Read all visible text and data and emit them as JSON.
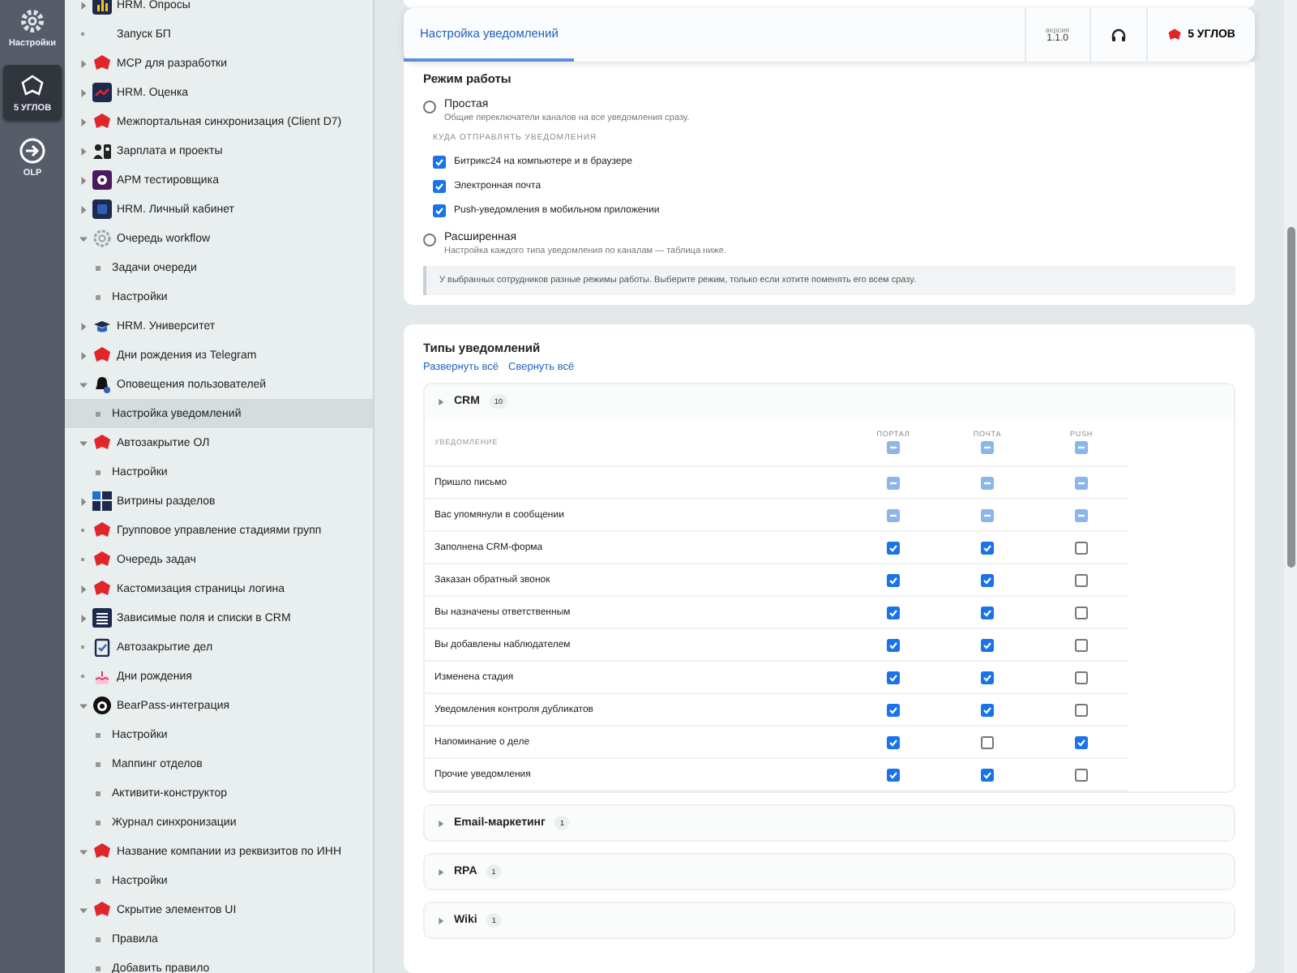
{
  "rail": [
    {
      "label": "Настройки",
      "selected": false
    },
    {
      "label": "5 УГЛОВ",
      "selected": true
    },
    {
      "label": "OLP",
      "selected": false
    }
  ],
  "sidebar": {
    "items": [
      {
        "label": "HRM. Опросы",
        "kind": "folder",
        "expanded": false,
        "selected": false
      },
      {
        "label": "Запуск БП",
        "kind": "leaf",
        "selected": false
      },
      {
        "label": "МСР для разработки",
        "kind": "folder",
        "expanded": false,
        "selected": false
      },
      {
        "label": "HRM. Оценка",
        "kind": "folder",
        "expanded": false,
        "selected": false
      },
      {
        "label": "Межпортальная синхронизация (Client D7)",
        "kind": "folder",
        "expanded": false,
        "selected": false
      },
      {
        "label": "Зарплата и проекты",
        "kind": "folder",
        "expanded": false,
        "selected": false
      },
      {
        "label": "АРМ тестировщика",
        "kind": "folder",
        "expanded": false,
        "selected": false
      },
      {
        "label": "HRM. Личный кабинет",
        "kind": "folder",
        "expanded": false,
        "selected": false
      },
      {
        "label": "Очередь workflow",
        "kind": "folder",
        "expanded": true,
        "selected": false,
        "children": [
          {
            "label": "Задачи очереди",
            "selected": false
          },
          {
            "label": "Настройки",
            "selected": false
          }
        ]
      },
      {
        "label": "HRM. Университет",
        "kind": "folder",
        "expanded": false,
        "selected": false
      },
      {
        "label": "Дни рождения из Telegram",
        "kind": "folder",
        "expanded": false,
        "selected": false
      },
      {
        "label": "Оповещения пользователей",
        "kind": "folder",
        "expanded": true,
        "selected": false,
        "children": [
          {
            "label": "Настройка уведомлений",
            "selected": true
          }
        ]
      },
      {
        "label": "Автозакрытие ОЛ",
        "kind": "folder",
        "expanded": true,
        "selected": false,
        "children": [
          {
            "label": "Настройки",
            "selected": false
          }
        ]
      },
      {
        "label": "Витрины разделов",
        "kind": "folder",
        "expanded": false,
        "selected": false
      },
      {
        "label": "Групповое управление стадиями групп",
        "kind": "leaf",
        "selected": false
      },
      {
        "label": "Очередь задач",
        "kind": "leaf",
        "selected": false
      },
      {
        "label": "Кастомизация страницы логина",
        "kind": "folder",
        "expanded": false,
        "selected": false
      },
      {
        "label": "Зависимые поля и списки в CRM",
        "kind": "folder",
        "expanded": false,
        "selected": false
      },
      {
        "label": "Автозакрытие дел",
        "kind": "leaf",
        "selected": false
      },
      {
        "label": "Дни рождения",
        "kind": "leaf",
        "selected": false
      },
      {
        "label": "BearPass-интеграция",
        "kind": "folder",
        "expanded": true,
        "selected": false,
        "children": [
          {
            "label": "Настройки",
            "selected": false
          },
          {
            "label": "Маппинг отделов",
            "selected": false
          },
          {
            "label": "Активити-конструктор",
            "selected": false
          },
          {
            "label": "Журнал синхронизации",
            "selected": false
          }
        ]
      },
      {
        "label": "Название компании из реквизитов по ИНН",
        "kind": "folder",
        "expanded": true,
        "selected": false,
        "children": [
          {
            "label": "Настройки",
            "selected": false
          }
        ]
      },
      {
        "label": "Скрытие элементов UI",
        "kind": "folder",
        "expanded": true,
        "selected": false,
        "children": [
          {
            "label": "Правила",
            "selected": false
          },
          {
            "label": "Добавить правило",
            "selected": false
          }
        ]
      }
    ]
  },
  "header": {
    "tabs": [
      {
        "label": "Настройка уведомлений",
        "selected": true
      }
    ],
    "version_label": "версия",
    "version": "1.1.0",
    "brand": "5 УГЛОВ"
  },
  "mode": {
    "title": "Режим работы",
    "options": [
      {
        "label": "Простая",
        "description": "Общие переключатели каналов на все уведомления сразу.",
        "selected": false,
        "channels_title": "КУДА ОТПРАВЛЯТЬ УВЕДОМЛЕНИЯ",
        "channels": [
          {
            "label": "Битрикс24 на компьютере и в браузере",
            "checked": true
          },
          {
            "label": "Электронная почта",
            "checked": true
          },
          {
            "label": "Push-уведомления в мобильном приложении",
            "checked": true
          }
        ]
      },
      {
        "label": "Расширенная",
        "description": "Настройка каждого типа уведомления по каналам — таблица ниже.",
        "selected": false
      }
    ],
    "note": "У выбранных сотрудников разные режимы работы. Выберите режим, только если хотите поменять его всем сразу."
  },
  "types": {
    "title": "Типы уведомлений",
    "links": [
      "Развернуть всё",
      "Свернуть всё"
    ],
    "groups": [
      {
        "name": "CRM",
        "count": "10",
        "first_column": "УВЕДОМЛЕНИЕ",
        "columns": [
          {
            "label": "ПОРТАЛ",
            "mixed": true
          },
          {
            "label": "ПОЧТА",
            "mixed": true
          },
          {
            "label": "PUSH",
            "mixed": true
          }
        ],
        "rows": [
          {
            "label": "Пришло письмо",
            "cells": [
              {
                "mixed": true
              },
              {
                "mixed": true
              },
              {
                "mixed": true
              }
            ]
          },
          {
            "label": "Вас упомянули в сообщении",
            "cells": [
              {
                "mixed": true
              },
              {
                "mixed": true
              },
              {
                "mixed": true
              }
            ]
          },
          {
            "label": "Заполнена CRM-форма",
            "cells": [
              {
                "checked": true
              },
              {
                "checked": true
              },
              {
                "checked": false
              }
            ]
          },
          {
            "label": "Заказан обратный звонок",
            "cells": [
              {
                "checked": true
              },
              {
                "checked": true
              },
              {
                "checked": false
              }
            ]
          },
          {
            "label": "Вы назначены ответственным",
            "cells": [
              {
                "checked": true
              },
              {
                "checked": true
              },
              {
                "checked": false
              }
            ]
          },
          {
            "label": "Вы добавлены наблюдателем",
            "cells": [
              {
                "checked": true
              },
              {
                "checked": true
              },
              {
                "checked": false
              }
            ]
          },
          {
            "label": "Изменена стадия",
            "cells": [
              {
                "checked": true
              },
              {
                "checked": true
              },
              {
                "checked": false
              }
            ]
          },
          {
            "label": "Уведомления контроля дубликатов",
            "cells": [
              {
                "checked": true
              },
              {
                "checked": true
              },
              {
                "checked": false
              }
            ]
          },
          {
            "label": "Напоминание о деле",
            "cells": [
              {
                "checked": true
              },
              {
                "checked": false
              },
              {
                "checked": true
              }
            ]
          },
          {
            "label": "Прочие уведомления",
            "cells": [
              {
                "checked": true
              },
              {
                "checked": true
              },
              {
                "checked": false
              }
            ]
          }
        ]
      },
      {
        "name": "Email-маркетинг",
        "count": "1"
      },
      {
        "name": "RPA",
        "count": "1"
      },
      {
        "name": "Wiki",
        "count": "1"
      }
    ]
  }
}
